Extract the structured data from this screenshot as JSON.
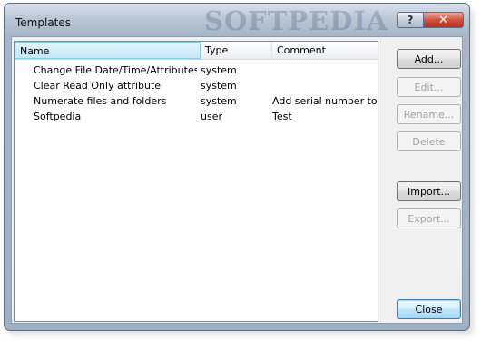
{
  "window": {
    "title": "Templates",
    "watermark": "SOFTPEDIA",
    "help_label": "?",
    "close_label": "✕"
  },
  "list": {
    "columns": [
      "Name",
      "Type",
      "Comment"
    ],
    "rows": [
      {
        "name": "Change File Date/Time/Attributes",
        "type": "system",
        "comment": ""
      },
      {
        "name": "Clear Read Only attribute",
        "type": "system",
        "comment": ""
      },
      {
        "name": "Numerate files and folders",
        "type": "system",
        "comment": "Add serial number to ..."
      },
      {
        "name": "Softpedia",
        "type": "user",
        "comment": "Test"
      }
    ]
  },
  "buttons": {
    "add": "Add...",
    "edit": "Edit...",
    "rename": "Rename...",
    "delete": "Delete",
    "import": "Import...",
    "export": "Export...",
    "close": "Close"
  }
}
